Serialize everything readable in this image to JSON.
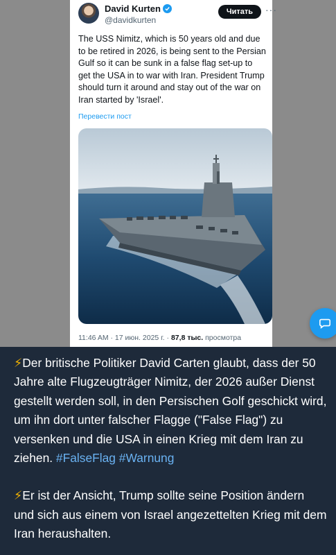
{
  "tweet": {
    "display_name": "David Kurten",
    "handle": "@davidkurten",
    "follow_label": "Читать",
    "more_label": "···",
    "text": "The USS Nimitz, which is 50 years old and due to be retired in 2026, is being sent to the Persian Gulf so it can be sunk in a false flag set-up to get the USA in to war with Iran. President Trump should turn it around and stay out of the war on Iran started by 'Israel'.",
    "translate_label": "Перевести пост",
    "timestamp": "11:46 AM · 17 июн. 2025 г. · ",
    "views_count": "87,8 тыс.",
    "views_label": " просмотра",
    "photo_icon": "aircraft-carrier-photo"
  },
  "post": {
    "paragraph1_icon": "⚡",
    "paragraph1_text": "Der britische Politiker David Carten glaubt, dass der 50 Jahre alte Flugzeugträger Nimitz, der 2026 außer Dienst gestellt werden soll, in den Persischen Golf geschickt wird, um ihn dort unter falscher Flagge (\"False Flag\") zu versenken und die USA in einen Krieg mit dem Iran zu ziehen. ",
    "hashtag1": "#FalseFlag",
    "hashtag2": "#Warnung",
    "paragraph2_icon": "⚡",
    "paragraph2_text": "Er ist der Ansicht, Trump sollte seine Position ändern und sich aus einem von Israel angezettelten Krieg mit dem Iran heraushalten."
  },
  "colors": {
    "chat_background": "#1e2a3a",
    "link_blue": "#1d9bf0",
    "hashtag_blue": "#6ab2f2"
  }
}
